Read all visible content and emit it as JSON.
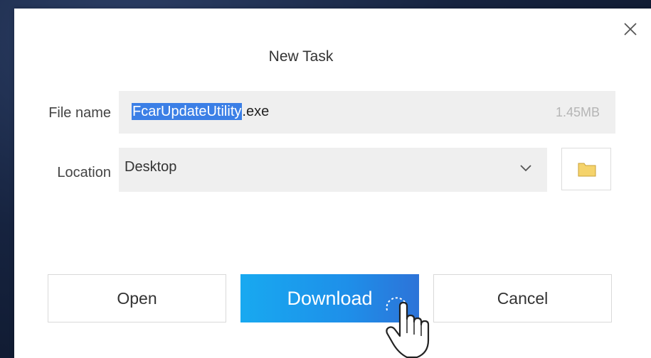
{
  "dialog": {
    "title": "New Task",
    "close_icon": "close-icon"
  },
  "file_name": {
    "label": "File name",
    "selected_part": "FcarUpdateUtility",
    "extension": ".exe",
    "size": "1.45MB"
  },
  "location": {
    "label": "Location",
    "value": "Desktop",
    "dropdown_icon": "chevron-down-icon",
    "browse_icon": "folder-icon"
  },
  "buttons": {
    "open": "Open",
    "download": "Download",
    "cancel": "Cancel"
  },
  "colors": {
    "primary_start": "#18a9f0",
    "primary_end": "#2d73d8",
    "selection": "#3b7fe6",
    "field_bg": "#efefef",
    "folder_fill": "#f5d36b"
  }
}
